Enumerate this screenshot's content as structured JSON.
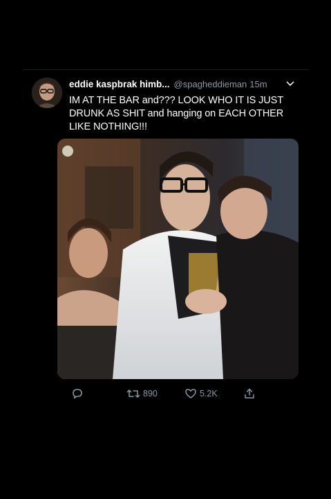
{
  "tweet": {
    "display_name": "eddie kaspbrak himb...",
    "handle": "@spagheddieman",
    "time": "15m",
    "text": "IM AT THE BAR and??? LOOK WHO IT IS JUST DRUNK AS SHIT and hanging on EACH OTHER LIKE NOTHING!!!"
  },
  "actions": {
    "reply_count": "",
    "retweet_count": "890",
    "like_count": "5.2K"
  },
  "icons": {
    "reply": "reply-icon",
    "retweet": "retweet-icon",
    "like": "heart-icon",
    "share": "share-icon",
    "more": "chevron-down-icon"
  },
  "colors": {
    "background": "#000000",
    "secondary_text": "#8b98a5",
    "primary_text": "#ffffff"
  }
}
